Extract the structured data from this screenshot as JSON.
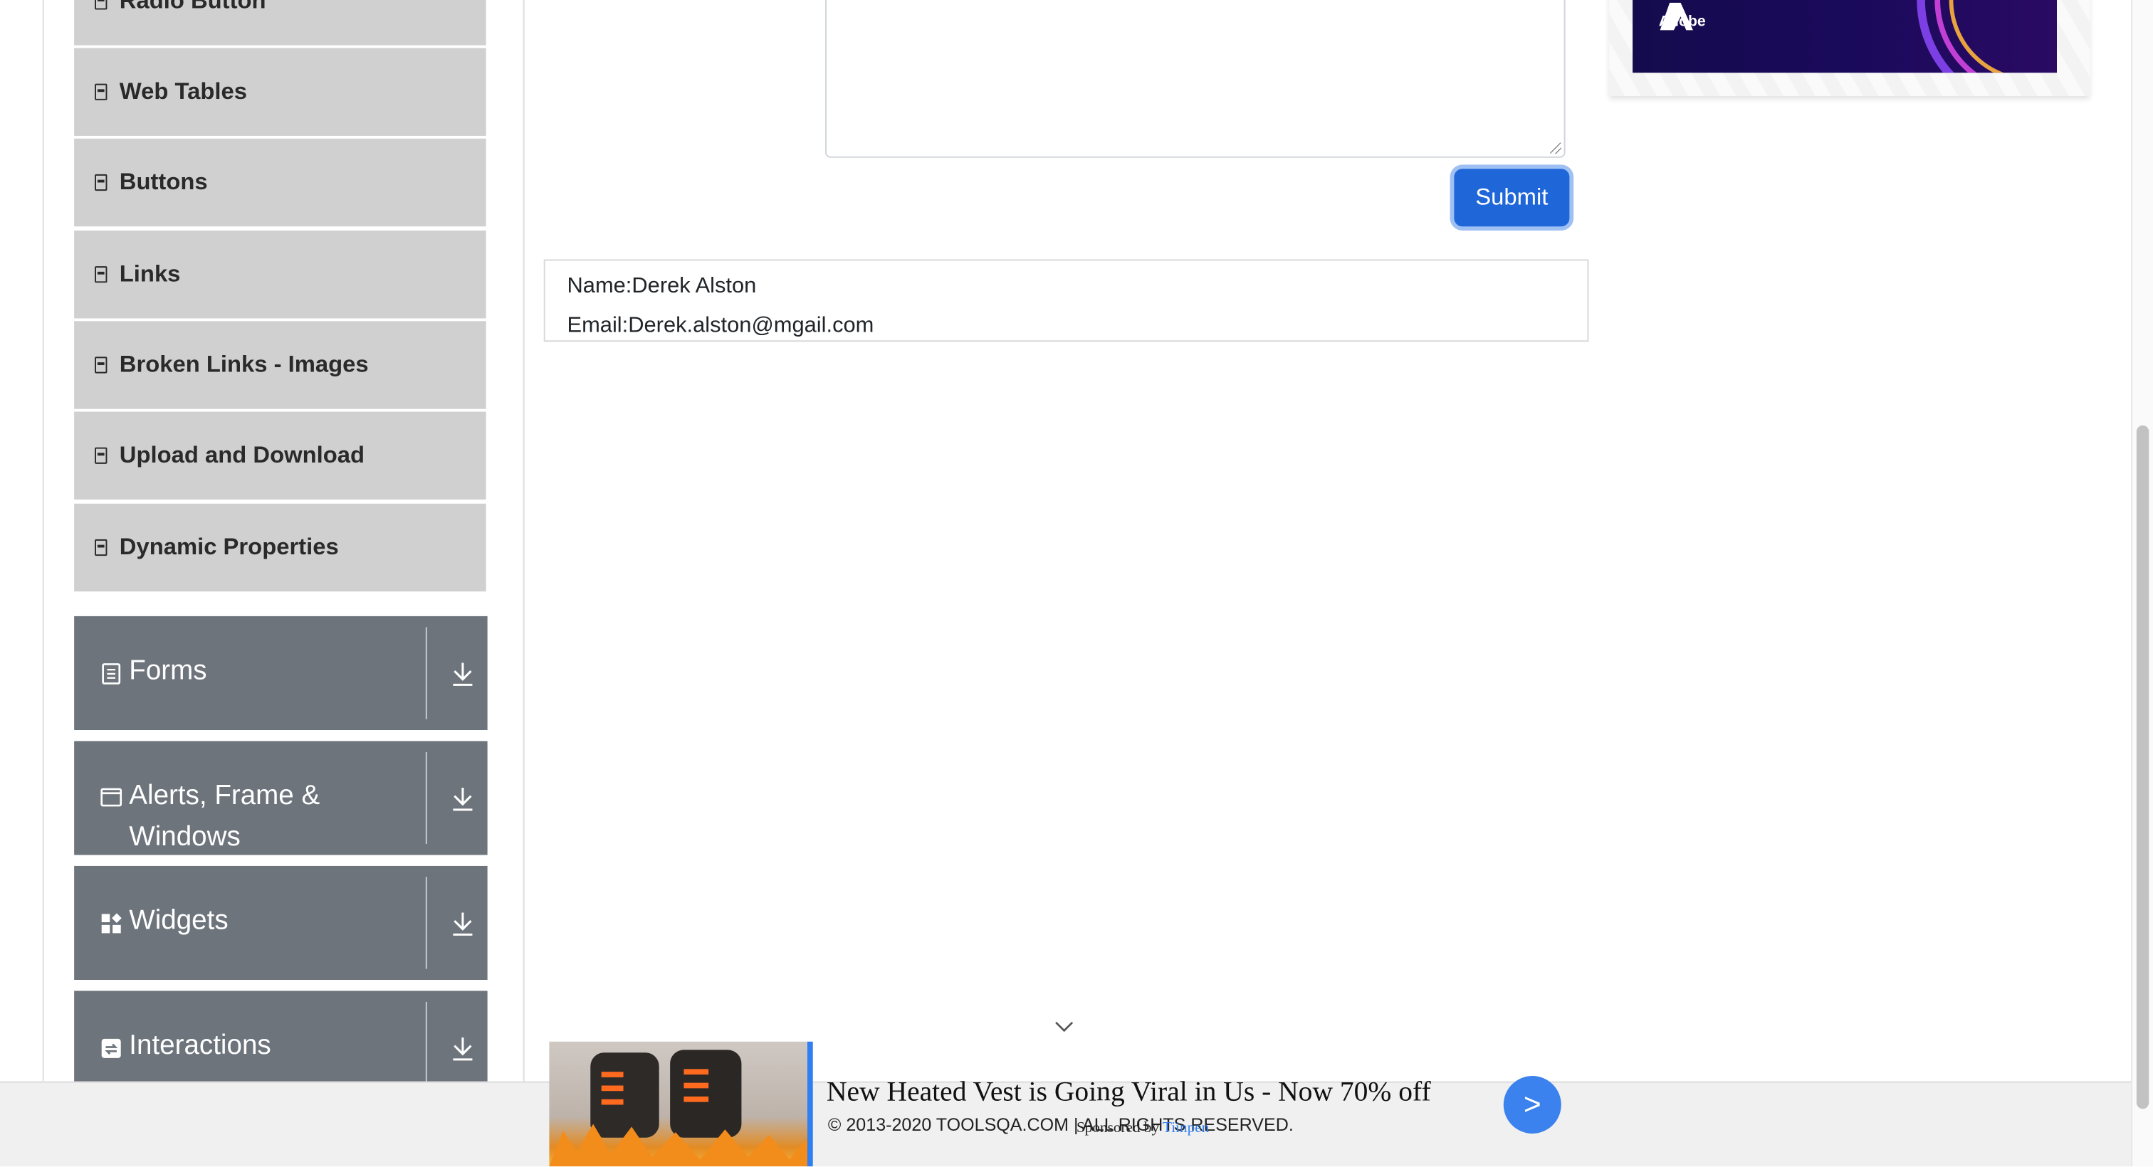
{
  "sidebar": {
    "items": [
      {
        "label": "Radio Button",
        "icon": "file-code-icon"
      },
      {
        "label": "Web Tables",
        "icon": "file-code-icon"
      },
      {
        "label": "Buttons",
        "icon": "file-code-icon"
      },
      {
        "label": "Links",
        "icon": "file-code-icon"
      },
      {
        "label": "Broken Links - Images",
        "icon": "file-code-icon"
      },
      {
        "label": "Upload and Download",
        "icon": "file-code-icon"
      },
      {
        "label": "Dynamic Properties",
        "icon": "file-code-icon"
      }
    ],
    "groups": [
      {
        "label": "Forms",
        "icon": "document-icon"
      },
      {
        "label": "Alerts, Frame &",
        "label2": "Windows",
        "icon": "window-icon"
      },
      {
        "label": "Widgets",
        "icon": "widgets-icon"
      },
      {
        "label": "Interactions",
        "icon": "interactions-icon"
      }
    ]
  },
  "form": {
    "submit_label": "Submit"
  },
  "output": {
    "name_line": "Name:Derek Alston",
    "email_line": "Email:Derek.alston@mgail.com"
  },
  "right_ad": {
    "brand": "Adobe"
  },
  "bottom_ad": {
    "headline": "New Heated Vest is Going Viral in Us - Now 70% off",
    "sponsored_prefix": "Sponsored by",
    "sponsor": "Tiinpen",
    "go_label": ">"
  },
  "footer": {
    "copyright": "© 2013-2020 TOOLSQA.COM | ALL RIGHTS RESERVED."
  },
  "colors": {
    "submit": "#1f66d9",
    "group_header": "#6d747c",
    "menu_item": "#d0d0d0",
    "ad_accent": "#2f7ef2"
  }
}
